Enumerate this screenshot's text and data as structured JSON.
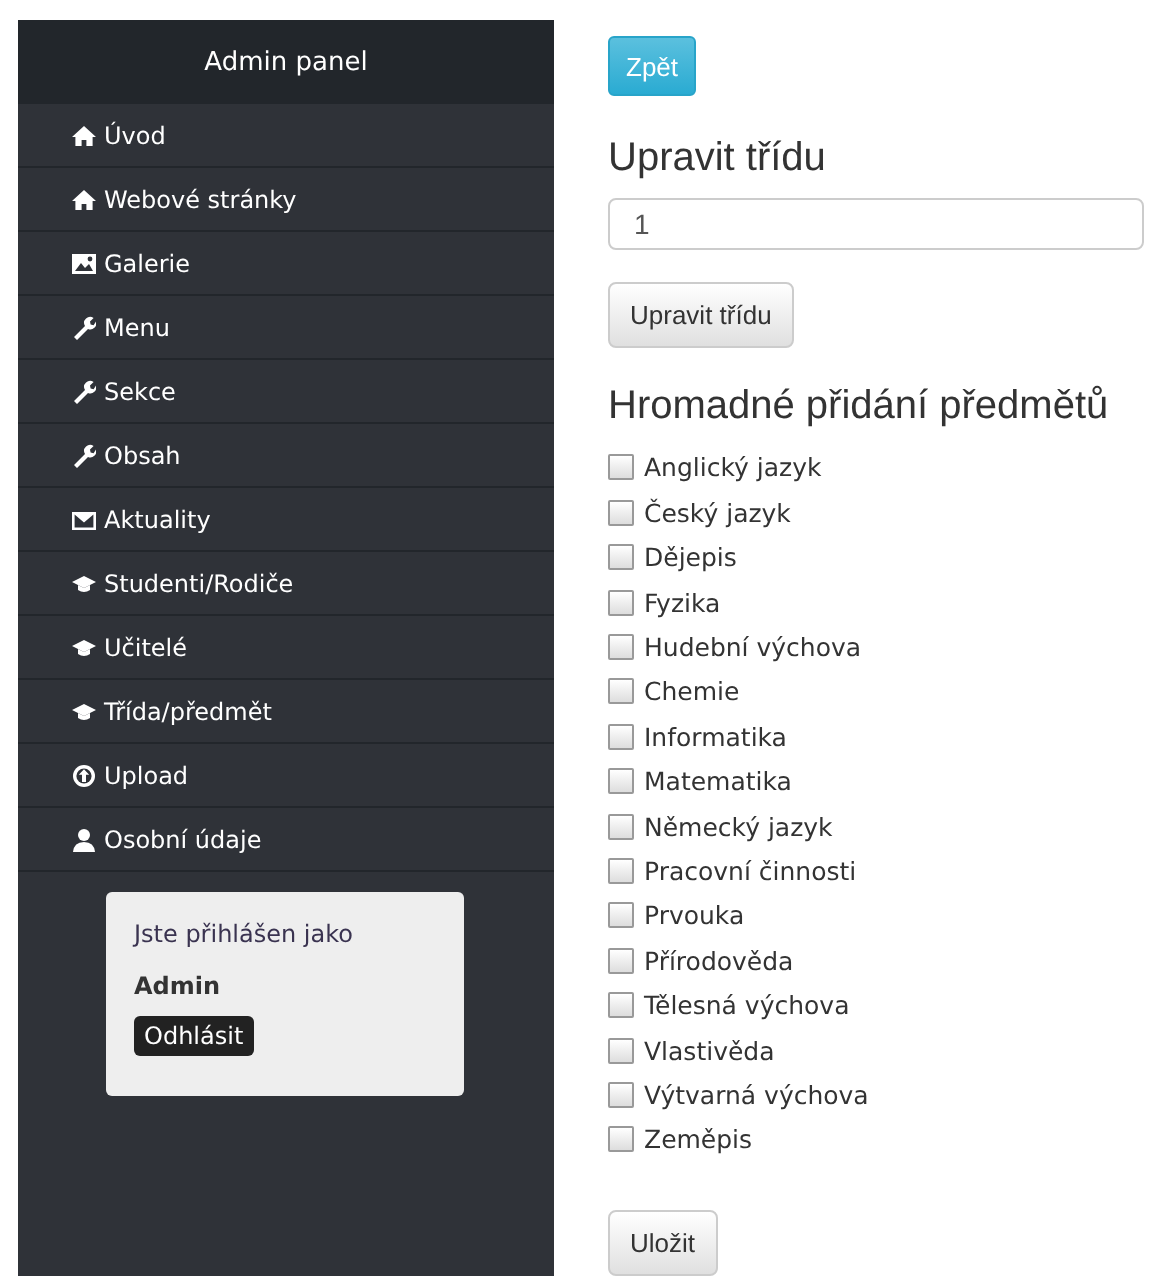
{
  "sidebar": {
    "title": "Admin panel",
    "items": [
      {
        "label": "Úvod",
        "kind": "home"
      },
      {
        "label": "Webové stránky",
        "kind": "home"
      },
      {
        "label": "Galerie",
        "kind": "image"
      },
      {
        "label": "Menu",
        "kind": "wrench"
      },
      {
        "label": "Sekce",
        "kind": "wrench"
      },
      {
        "label": "Obsah",
        "kind": "wrench"
      },
      {
        "label": "Aktuality",
        "kind": "mail"
      },
      {
        "label": "Studenti/Rodiče",
        "kind": "cap"
      },
      {
        "label": "Učitelé",
        "kind": "cap"
      },
      {
        "label": "Třída/předmět",
        "kind": "cap"
      },
      {
        "label": "Upload",
        "kind": "upload"
      },
      {
        "label": "Osobní údaje",
        "kind": "user"
      }
    ],
    "login_card": {
      "text": "Jste přihlášen jako",
      "user": "Admin",
      "button": "Odhlásit"
    }
  },
  "main": {
    "back_button": "Zpět",
    "heading": "Upravit třídu",
    "class_field": {
      "value": "1"
    },
    "submit_button": "Upravit třídu",
    "subjects_heading": "Hromadné přidání předmětů",
    "subjects": [
      {
        "label": "Anglický jazyk",
        "checked": false
      },
      {
        "label": "Český jazyk",
        "checked": false
      },
      {
        "label": "Dějepis",
        "checked": false
      },
      {
        "label": "Fyzika",
        "checked": false
      },
      {
        "label": "Hudební výchova",
        "checked": false
      },
      {
        "label": "Chemie",
        "checked": false
      },
      {
        "label": "Informatika",
        "checked": false
      },
      {
        "label": "Matematika",
        "checked": false
      },
      {
        "label": "Německý jazyk",
        "checked": false
      },
      {
        "label": "Pracovní činnosti",
        "checked": false
      },
      {
        "label": "Prvouka",
        "checked": false
      },
      {
        "label": "Přírodověda",
        "checked": false
      },
      {
        "label": "Tělesná výchova",
        "checked": false
      },
      {
        "label": "Vlastivěda",
        "checked": false
      },
      {
        "label": "Výtvarná výchova",
        "checked": false
      },
      {
        "label": "Zeměpis",
        "checked": false
      }
    ],
    "save_button": "Uložit"
  }
}
